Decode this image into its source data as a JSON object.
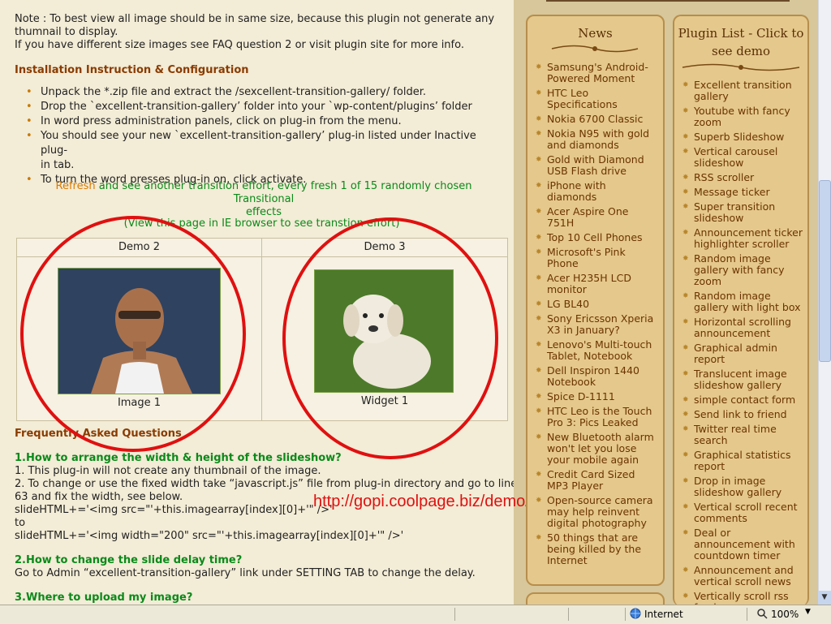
{
  "note": {
    "line1": "Note : To best view all image should be in same size, because this plugin not generate any",
    "line2": "thumnail to display.",
    "line3": "If you have different size images see FAQ question 2 or visit plugin site for more info."
  },
  "install": {
    "heading": "Installation Instruction & Configuration",
    "steps": [
      "Unpack the *.zip file and extract the /sexcellent-transition-gallery/ folder.",
      "Drop the `excellent-transition-gallery’ folder into your `wp-content/plugins’ folder",
      "In word press administration panels, click on plug-in from the menu.",
      "You should see your new `excellent-transition-gallery’ plug-in listed under Inactive plug-",
      "in tab.",
      "To turn the word presses plug-in on, click activate."
    ]
  },
  "refresh": {
    "link": "Refresh",
    "rest1": " and see another transition effort, every fresh 1 of 15 randomly chosen Transitional",
    "rest2": "effects"
  },
  "ie_note": "(View this page in  IE browser to see transtion effort)",
  "demos": [
    {
      "header": "Demo 2",
      "caption": "Image 1"
    },
    {
      "header": "Demo 3",
      "caption": "Widget 1"
    }
  ],
  "faq": {
    "heading": "Frequently Asked Questions",
    "q1": "1.How to arrange the width & height of the slideshow?",
    "a1_1": "1. This plug-in will not create any thumbnail of the image.",
    "a1_2": "2. To change or use the fixed width take “javascript.js” file from plug-in directory and go to line",
    "a1_3": "63 and fix the width, see below.",
    "a1_4": "slideHTML+='<img src=\"'+this.imagearray[index][0]+'\" />'",
    "a1_5": "to",
    "a1_6": "slideHTML+='<img width=\"200\" src=\"'+this.imagearray[index][0]+'\" />'",
    "q2": "2.How to change the slide delay time?",
    "a2": "Go to Admin “excellent-transition-gallery” link under SETTING TAB to change the delay.",
    "q3": "3.Where to upload my image?"
  },
  "overlay_url": "http://gopi.coolpage.biz/demo/",
  "news": {
    "title": "News",
    "items": [
      "Samsung's Android-Powered Moment",
      "HTC Leo Specifications",
      "Nokia 6700 Classic",
      "Nokia N95 with gold and diamonds",
      "Gold with Diamond USB Flash drive",
      "iPhone with diamonds",
      "Acer Aspire One 751H",
      "Top 10 Cell Phones",
      "Microsoft's Pink Phone",
      "Acer H235H LCD monitor",
      "LG BL40",
      "Sony Ericsson Xperia X3 in January?",
      "Lenovo's Multi-touch Tablet, Notebook",
      "Dell Inspiron 1440 Notebook",
      "Spice D-1111",
      "HTC Leo is the Touch Pro 3: Pics Leaked",
      "New Bluetooth alarm won't let you lose your mobile again",
      "Credit Card Sized MP3 Player",
      "Open-source camera may help reinvent digital photography",
      "50 things that are being killed by the Internet"
    ]
  },
  "plugins": {
    "title": "Plugin List - Click to see demo",
    "items": [
      "Excellent transition gallery",
      "Youtube with fancy zoom",
      "Superb Slideshow",
      "Vertical carousel slideshow",
      "RSS scroller",
      "Message ticker",
      "Super transition slideshow",
      "Announcement ticker highlighter scroller",
      "Random image gallery with fancy zoom",
      "Random image gallery with light box",
      "Horizontal scrolling announcement",
      "Graphical admin report",
      "Translucent image slideshow gallery",
      "simple contact form",
      "Send link to friend",
      "Twitter real time search",
      "Graphical statistics report",
      "Drop in image slideshow gallery",
      "Vertical scroll recent comments",
      "Deal or announcement with countdown timer",
      "Announcement and vertical scroll news",
      "Vertically scroll rss feed"
    ]
  },
  "statusbar": {
    "zone": "Internet",
    "zoom": "100%"
  },
  "colors": {
    "heading_brown": "#8a3b00",
    "link_green": "#0a8a1a",
    "refresh_orange": "#d97a00",
    "annotation_red": "#e01010",
    "panel_tan": "#e5c88c"
  }
}
